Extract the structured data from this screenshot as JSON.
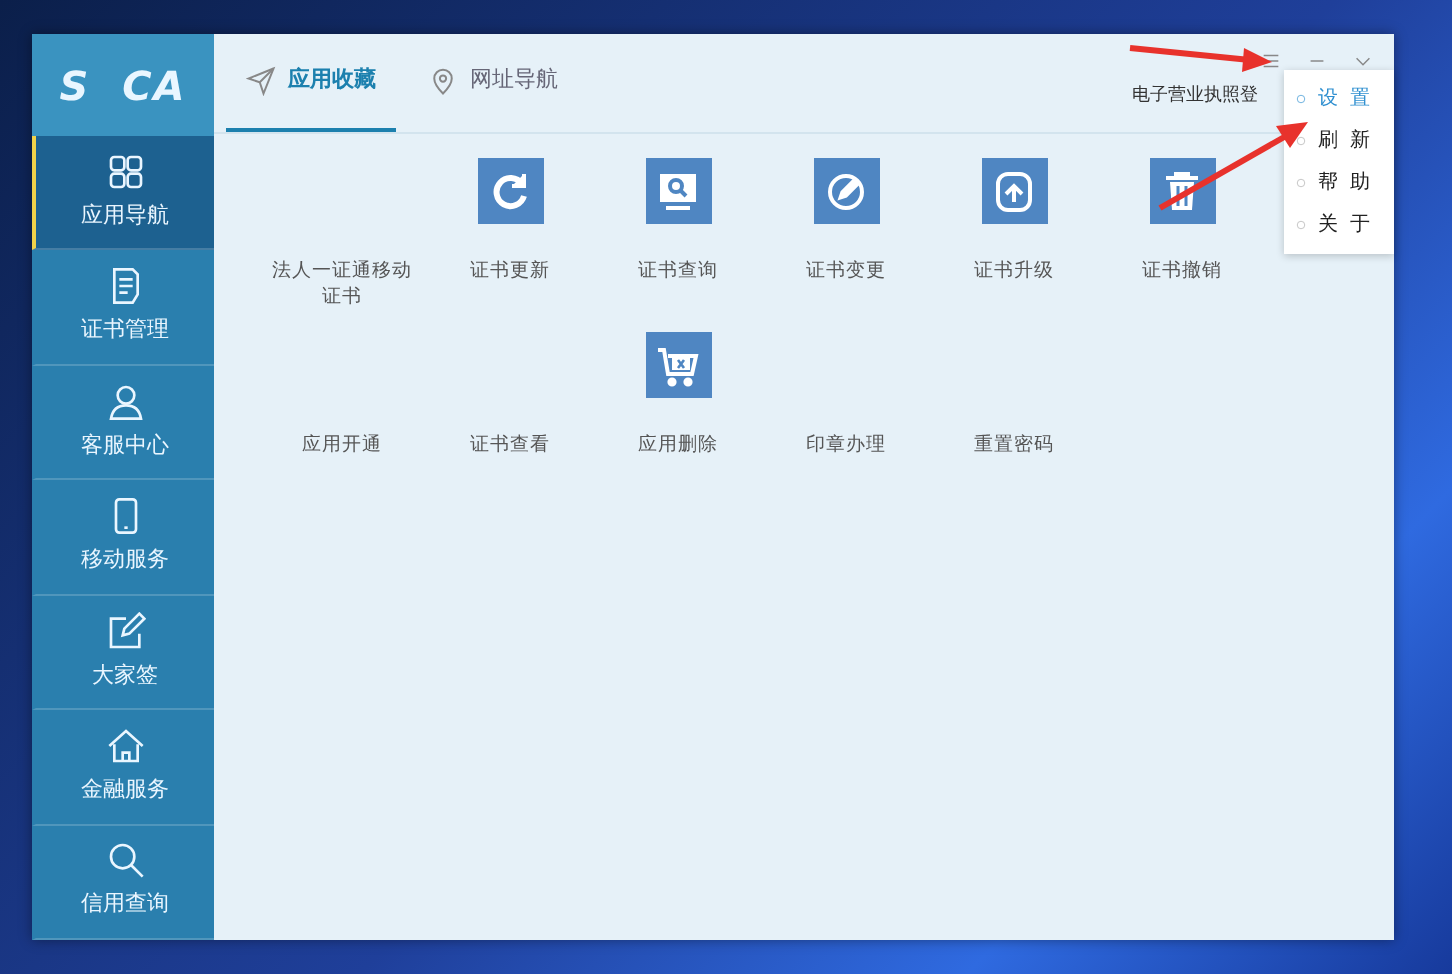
{
  "sidebar": {
    "logo": "S  CA",
    "items": [
      {
        "label": "应用导航",
        "selected": true
      },
      {
        "label": "证书管理",
        "selected": false
      },
      {
        "label": "客服中心",
        "selected": false
      },
      {
        "label": "移动服务",
        "selected": false
      },
      {
        "label": "大家签",
        "selected": false
      },
      {
        "label": "金融服务",
        "selected": false
      },
      {
        "label": "信用查询",
        "selected": false
      }
    ]
  },
  "tabs": [
    {
      "label": "应用收藏",
      "selected": true
    },
    {
      "label": "网址导航",
      "selected": false
    }
  ],
  "header_text": "电子营业执照登",
  "apps": [
    {
      "label": "法人一证通移动证书",
      "kind": "text"
    },
    {
      "label": "证书更新",
      "kind": "tile"
    },
    {
      "label": "证书查询",
      "kind": "tile"
    },
    {
      "label": "证书变更",
      "kind": "tile"
    },
    {
      "label": "证书升级",
      "kind": "tile"
    },
    {
      "label": "证书撤销",
      "kind": "tile"
    },
    {
      "label": "应用开通",
      "kind": "text"
    },
    {
      "label": "证书查看",
      "kind": "text"
    },
    {
      "label": "应用删除",
      "kind": "tile"
    },
    {
      "label": "印章办理",
      "kind": "text"
    },
    {
      "label": "重置密码",
      "kind": "text"
    }
  ],
  "menu": [
    {
      "label": "设置",
      "selected": true
    },
    {
      "label": "刷新",
      "selected": false
    },
    {
      "label": "帮助",
      "selected": false
    },
    {
      "label": "关于",
      "selected": false
    }
  ]
}
